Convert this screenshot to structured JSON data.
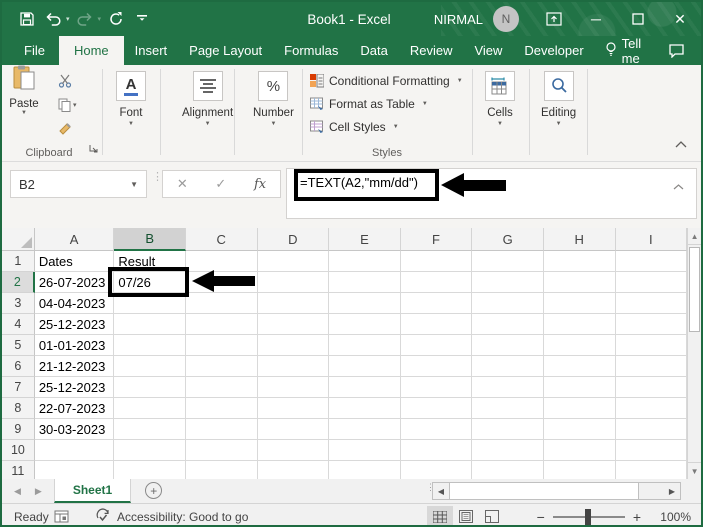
{
  "window": {
    "title": "Book1 - Excel",
    "user": "NIRMAL",
    "avatar_initial": "N"
  },
  "tabs": {
    "active": "Home",
    "items": [
      "File",
      "Home",
      "Insert",
      "Page Layout",
      "Formulas",
      "Data",
      "Review",
      "View",
      "Developer"
    ],
    "tell_me": "Tell me"
  },
  "ribbon": {
    "clipboard": {
      "paste_label": "Paste",
      "group_label": "Clipboard"
    },
    "font": {
      "label": "Font"
    },
    "alignment": {
      "label": "Alignment"
    },
    "number": {
      "label": "Number"
    },
    "styles": {
      "items": [
        "Conditional Formatting",
        "Format as Table",
        "Cell Styles"
      ],
      "group_label": "Styles"
    },
    "cells": {
      "label": "Cells"
    },
    "editing": {
      "label": "Editing"
    }
  },
  "formula_bar": {
    "name_box": "B2",
    "formula": "=TEXT(A2,\"mm/dd\")",
    "fx_label": "fx"
  },
  "grid": {
    "columns": [
      "A",
      "B",
      "C",
      "D",
      "E",
      "F",
      "G",
      "H",
      "I"
    ],
    "selected_column": "B",
    "selected_row": 2,
    "row_numbers": [
      1,
      2,
      3,
      4,
      5,
      6,
      7,
      8,
      9,
      10,
      11
    ],
    "cells": {
      "A": [
        "Dates",
        "26-07-2023",
        "04-04-2023",
        "25-12-2023",
        "01-01-2023",
        "21-12-2023",
        "25-12-2023",
        "22-07-2023",
        "30-03-2023",
        "",
        ""
      ],
      "B": [
        "Result",
        "07/26",
        "",
        "",
        "",
        "",
        "",
        "",
        "",
        "",
        ""
      ]
    }
  },
  "sheet_bar": {
    "active_tab": "Sheet1",
    "add_label": "+"
  },
  "status_bar": {
    "ready": "Ready",
    "accessibility": "Accessibility: Good to go",
    "zoom": "100%"
  },
  "colors": {
    "accent_green": "#217346",
    "annotation": "#000000"
  }
}
